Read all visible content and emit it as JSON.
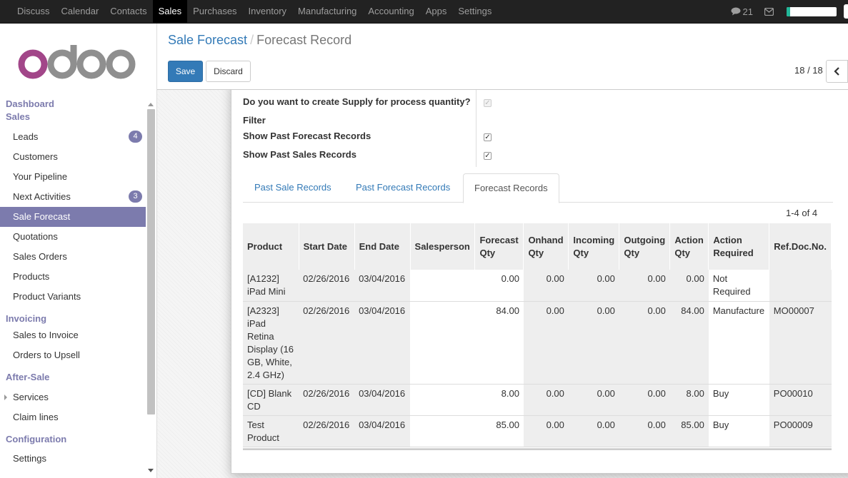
{
  "topbar": {
    "menu": [
      "Discuss",
      "Calendar",
      "Contacts",
      "Sales",
      "Purchases",
      "Inventory",
      "Manufacturing",
      "Accounting",
      "Apps",
      "Settings"
    ],
    "active": "Sales",
    "messages_count": "21",
    "icons": [
      "chat-icon",
      "envelope-icon"
    ],
    "progress_fraction": 0.07,
    "progress_color": "#21b799"
  },
  "sidebar": {
    "logo_text": "odoo",
    "sections": [
      {
        "title": "Dashboard"
      },
      {
        "title": "Sales",
        "items": [
          {
            "label": "Leads",
            "badge": "4"
          },
          {
            "label": "Customers"
          },
          {
            "label": "Your Pipeline"
          },
          {
            "label": "Next Activities",
            "badge": "3"
          },
          {
            "label": "Sale Forecast",
            "active": true
          },
          {
            "label": "Quotations"
          },
          {
            "label": "Sales Orders"
          },
          {
            "label": "Products"
          },
          {
            "label": "Product Variants"
          }
        ]
      },
      {
        "title": "Invoicing",
        "items": [
          {
            "label": "Sales to Invoice"
          },
          {
            "label": "Orders to Upsell"
          }
        ]
      },
      {
        "title": "After-Sale",
        "items": [
          {
            "label": "Services",
            "expandable": true
          },
          {
            "label": "Claim lines"
          }
        ]
      },
      {
        "title": "Configuration",
        "items": [
          {
            "label": "Settings"
          }
        ]
      }
    ]
  },
  "control": {
    "breadcrumb_parent": "Sale Forecast",
    "breadcrumb_sep": "/",
    "breadcrumb_current": "Forecast Record",
    "save_label": "Save",
    "discard_label": "Discard",
    "pager": "18 / 18"
  },
  "form": {
    "fields": [
      {
        "label": "Do you want to create Supply for process quantity?",
        "checked": true,
        "disabled": true
      },
      {
        "label": "Filter",
        "group": true
      },
      {
        "label": "Show Past Forecast Records",
        "checked": true
      },
      {
        "label": "Show Past Sales Records",
        "checked": true
      }
    ],
    "tabs": [
      "Past Sale Records",
      "Past Forecast Records",
      "Forecast Records"
    ],
    "active_tab": "Forecast Records",
    "record_count": "1-4 of 4",
    "columns": [
      "Product",
      "Start Date",
      "End Date",
      "Salesperson",
      "Forecast Qty",
      "Onhand Qty",
      "Incoming Qty",
      "Outgoing Qty",
      "Action Qty",
      "Action Required",
      "Ref.Doc.No."
    ],
    "rows": [
      [
        "[A1232] iPad Mini",
        "02/26/2016",
        "03/04/2016",
        "",
        "0.00",
        "0.00",
        "0.00",
        "0.00",
        "0.00",
        "Not Required",
        ""
      ],
      [
        "[A2323] iPad Retina Display (16 GB, White, 2.4 GHz)",
        "02/26/2016",
        "03/04/2016",
        "",
        "84.00",
        "0.00",
        "0.00",
        "0.00",
        "84.00",
        "Manufacture",
        "MO00007"
      ],
      [
        "[CD] Blank CD",
        "02/26/2016",
        "03/04/2016",
        "",
        "8.00",
        "0.00",
        "0.00",
        "0.00",
        "8.00",
        "Buy",
        "PO00010"
      ],
      [
        "Test Product",
        "02/26/2016",
        "03/04/2016",
        "",
        "85.00",
        "0.00",
        "0.00",
        "0.00",
        "85.00",
        "Buy",
        "PO00009"
      ]
    ]
  }
}
